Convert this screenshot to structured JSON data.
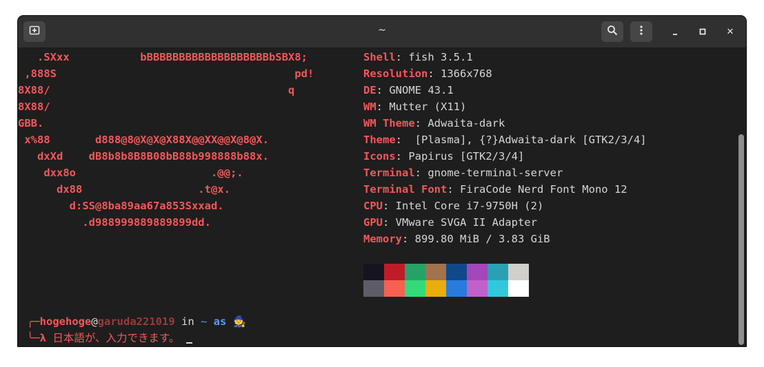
{
  "window": {
    "title": "~"
  },
  "titlebar_icons": {
    "new_tab": "new-tab-icon",
    "search": "search-icon",
    "menu": "kebab-menu-icon",
    "minimize": "minimize-icon",
    "maximize": "maximize-icon",
    "close": "close-icon",
    "close_glyph": "✕"
  },
  "ascii_art": [
    "   .SXxx           bBBBBBBBBBBBBBBBBBBBbSBX8;",
    " ,888S                                     pd!",
    "8X88/                                     q",
    "8X88/",
    "GBB.",
    " x%88       d888@8@X@X@X88X@@XX@@X@8@X.",
    "   dxXd    dB8b8b8B8B08bB88b998888b88x.",
    "    dxx8o                     .@@;.",
    "      dx88                  .t@x.",
    "        d:SS@8ba89aa67a853Sxxad.",
    "          .d988999889889899dd."
  ],
  "info": [
    {
      "key": "Shell",
      "sep": ": ",
      "value": "fish 3.5.1"
    },
    {
      "key": "Resolution",
      "sep": ": ",
      "value": "1366x768"
    },
    {
      "key": "DE",
      "sep": ": ",
      "value": "GNOME 43.1"
    },
    {
      "key": "WM",
      "sep": ": ",
      "value": "Mutter (X11)"
    },
    {
      "key": "WM Theme",
      "sep": ": ",
      "value": "Adwaita-dark"
    },
    {
      "key": "Theme",
      "sep": ":  ",
      "value": "[Plasma], {?}Adwaita-dark [GTK2/3/4]"
    },
    {
      "key": "Icons",
      "sep": ": ",
      "value": "Papirus [GTK2/3/4]"
    },
    {
      "key": "Terminal",
      "sep": ": ",
      "value": "gnome-terminal-server"
    },
    {
      "key": "Terminal Font",
      "sep": ": ",
      "value": "FiraCode Nerd Font Mono 12"
    },
    {
      "key": "CPU",
      "sep": ": ",
      "value": "Intel Core i7-9750H (2)"
    },
    {
      "key": "GPU",
      "sep": ": ",
      "value": "VMware SVGA II Adapter"
    },
    {
      "key": "Memory",
      "sep": ": ",
      "value": "899.80 MiB / 3.83 GiB"
    }
  ],
  "palette": {
    "row1": [
      "#171421",
      "#c01c28",
      "#26a269",
      "#a2734c",
      "#12488b",
      "#a347ba",
      "#2aa1b3",
      "#d0cfcc"
    ],
    "row2": [
      "#5e5c64",
      "#f66151",
      "#33da7a",
      "#e9ad0c",
      "#2a7bde",
      "#c061cb",
      "#33c7de",
      "#ffffff"
    ]
  },
  "prompt": {
    "corner_top": "╭─",
    "corner_bottom": "╰─",
    "user": "hogehoge",
    "at": "@",
    "host": "garuda221019",
    "in": " in ",
    "dir": "~",
    "as": " as ",
    "emoji": "🧙",
    "symbol": "λ",
    "command": " 日本語が、入力できます。 "
  }
}
